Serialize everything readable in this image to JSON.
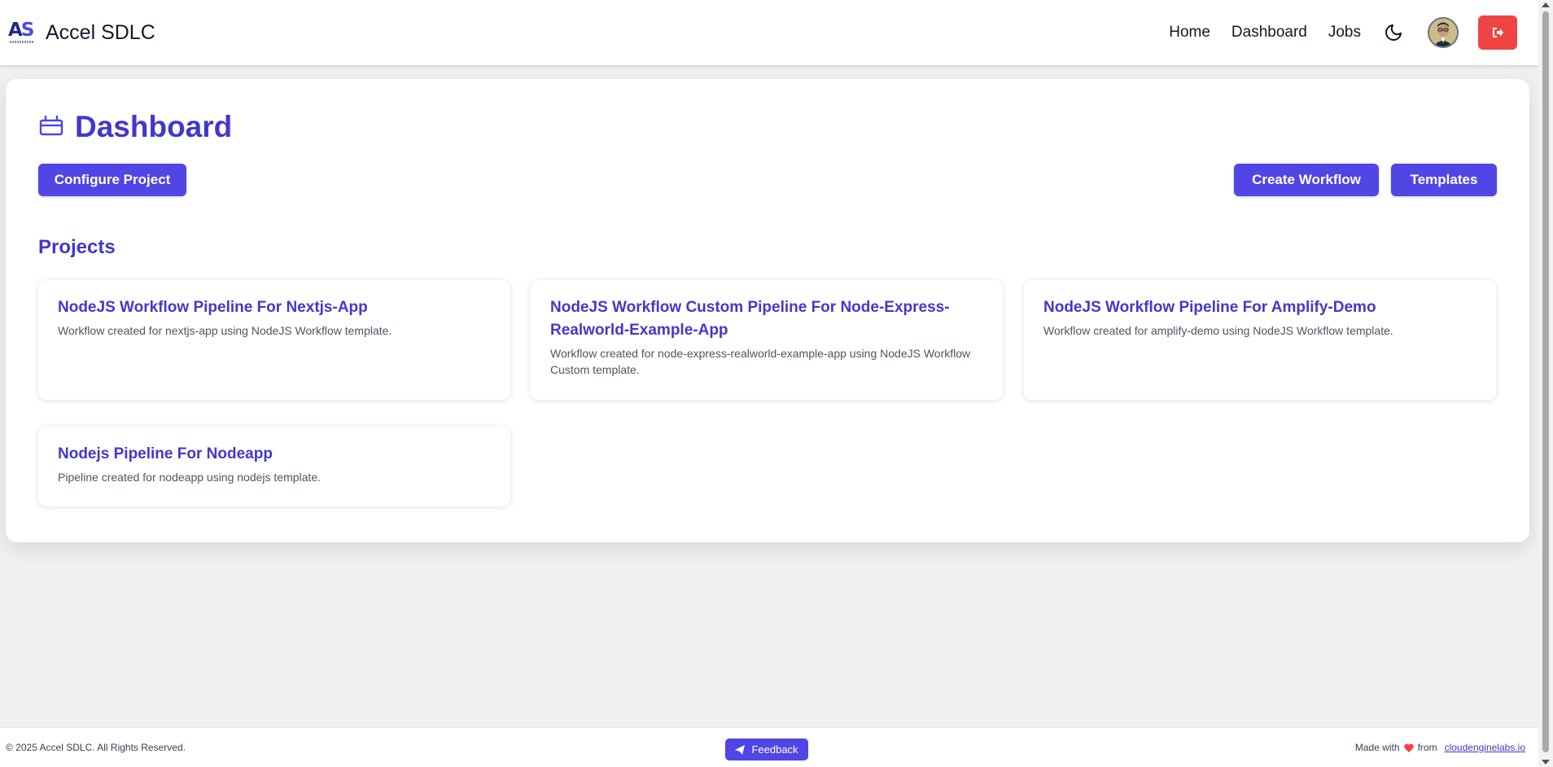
{
  "header": {
    "logo_text_a": "A",
    "logo_text_s": "S",
    "app_title": "Accel SDLC",
    "nav": [
      {
        "label": "Home"
      },
      {
        "label": "Dashboard"
      },
      {
        "label": "Jobs"
      }
    ],
    "icons": {
      "theme_toggle": "moon-icon",
      "logout": "logout-icon"
    }
  },
  "main": {
    "page_title": "Dashboard",
    "buttons": {
      "configure": "Configure Project",
      "create_workflow": "Create Workflow",
      "templates": "Templates"
    },
    "section_title": "Projects",
    "projects": [
      {
        "title": "NodeJS Workflow Pipeline For Nextjs-App",
        "description": "Workflow created for nextjs-app using NodeJS Workflow template."
      },
      {
        "title": "NodeJS Workflow Custom Pipeline For Node-Express-Realworld-Example-App",
        "description": "Workflow created for node-express-realworld-example-app using NodeJS Workflow Custom template."
      },
      {
        "title": "NodeJS Workflow Pipeline For Amplify-Demo",
        "description": "Workflow created for amplify-demo using NodeJS Workflow template."
      },
      {
        "title": "Nodejs Pipeline For Nodeapp",
        "description": "Pipeline created for nodeapp using nodejs template."
      }
    ]
  },
  "footer": {
    "copyright": "© 2025 Accel SDLC. All Rights Reserved.",
    "feedback_label": "Feedback",
    "made_with": "Made with",
    "from": "from",
    "link_text": "cloudenginelabs.io"
  },
  "colors": {
    "accent": "#4f46e5",
    "title": "#4338ca",
    "danger": "#ef4444"
  }
}
